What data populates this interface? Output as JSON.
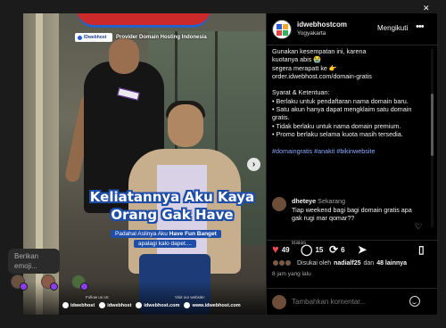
{
  "media": {
    "brand_badge": "IDwebhost",
    "brand_tagline": "Provider Domain Hosting Indonesia",
    "headline_line1": "Keliatannya Aku Kaya",
    "headline_line2": "Orang Gak Have",
    "subline_prefix": "Padahal Aslinya Aku",
    "subline_bold": "Have Fun Banget",
    "subline2": "apalagi kalo dapet....",
    "follow_label": "Follow us on:",
    "visit_label": "Visit our website:",
    "social": [
      "idwebhost",
      "idwebhost",
      "idwebhost.com",
      "www.idwebhost.com"
    ]
  },
  "emoji_popup": {
    "text": "Berikan emoji..."
  },
  "account": {
    "name": "idwebhostcom",
    "location": "Yogyakarta",
    "follow_label": "Mengikuti",
    "more": "•••"
  },
  "caption": {
    "lines_top": [
      "Gunakan kesempatan ini, karena",
      "kuotanya abis 😭",
      "segera merapatt ke 👉",
      "order.idwebhost.com/domain-gratis"
    ],
    "terms_title": "Syarat & Ketentuan:",
    "terms": [
      "• Berlaku untuk pendaftaran nama domain baru.",
      "• Satu akun hanya dapat mengklaim satu domain gratis.",
      "• Tidak berlaku untuk nama domain premium.",
      "• Promo berlaku selama kuota masih tersedia."
    ],
    "hashtags": "#domaingratis #anakit #bikinwebsite"
  },
  "comment": {
    "user": "dheteye",
    "time": "Sekarang",
    "text": "Tiap weekend bagi bagi domain gratis apa gak rugi mar qomar??",
    "reply": "Balas"
  },
  "actions": {
    "likes_count": "49",
    "comments_count": "15",
    "shares_count": "6"
  },
  "likes": {
    "prefix": "Disukai oleh",
    "user": "nadialf25",
    "connector": "dan",
    "others": "48 lainnya"
  },
  "time_ago": "8 jam yang lalu",
  "add_comment": {
    "placeholder": "Tambahkan komentar..."
  },
  "colors": {
    "like": "#ed4956",
    "hashtag": "#8aa9ff",
    "brand_blue": "#1f4ea8"
  }
}
